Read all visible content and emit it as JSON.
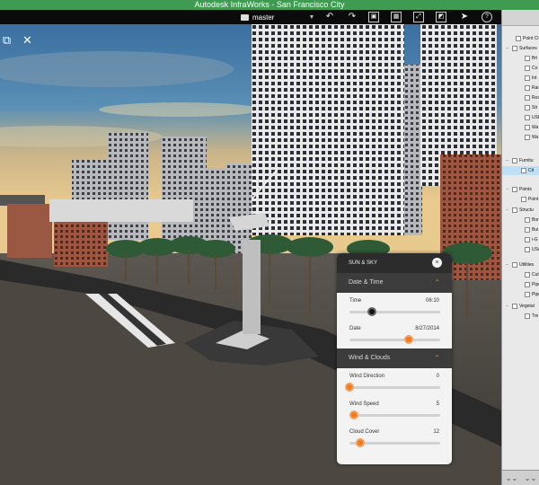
{
  "window": {
    "title": "Autodesk InfraWorks - San Francisco City"
  },
  "toolbar": {
    "project_name": "master",
    "dropdown_arrow": "▼",
    "icons": [
      "undo-icon",
      "redo-icon",
      "view-icon",
      "grid-icon",
      "capture-icon",
      "pointer-icon",
      "help-icon"
    ]
  },
  "scene_tools": {
    "icons": [
      "presentation-icon",
      "tools-icon"
    ]
  },
  "sun_sky_panel": {
    "title": "SUN & SKY",
    "close_glyph": "×",
    "sections": [
      {
        "label": "Date & Time",
        "rows": [
          {
            "label": "Time",
            "value": "06:10",
            "level": 0.25,
            "dark": true
          },
          {
            "label": "Date",
            "value": "8/27/2014",
            "level": 0.65,
            "dark": false
          }
        ]
      },
      {
        "label": "Wind & Clouds",
        "rows": [
          {
            "label": "Wind Direction",
            "value": "0",
            "level": 0.0,
            "dark": false
          },
          {
            "label": "Wind Speed",
            "value": "5",
            "level": 0.05,
            "dark": false
          },
          {
            "label": "Cloud Cover",
            "value": "12",
            "level": 0.12,
            "dark": false
          }
        ]
      }
    ]
  },
  "sidebar": {
    "items": [
      {
        "label": "Point Cl",
        "toggle": ""
      },
      {
        "label": "Surfaces",
        "toggle": "−"
      },
      {
        "label": "Bri",
        "toggle": ""
      },
      {
        "label": "Co",
        "toggle": ""
      },
      {
        "label": "Int",
        "toggle": ""
      },
      {
        "label": "Rai",
        "toggle": ""
      },
      {
        "label": "Roa",
        "toggle": ""
      },
      {
        "label": "Str",
        "toggle": ""
      },
      {
        "label": "USE",
        "toggle": ""
      },
      {
        "label": "Wa",
        "toggle": ""
      },
      {
        "label": "Wa",
        "toggle": ""
      },
      {
        "label": "Furnitu",
        "toggle": "−"
      },
      {
        "label": "Cit",
        "toggle": "",
        "selected": true
      },
      {
        "label": "Points",
        "toggle": "−"
      },
      {
        "label": "Point",
        "toggle": ""
      },
      {
        "label": "Structu",
        "toggle": "−"
      },
      {
        "label": "Bor",
        "toggle": ""
      },
      {
        "label": "Bui",
        "toggle": ""
      },
      {
        "label": "i-G",
        "toggle": ""
      },
      {
        "label": "USe",
        "toggle": ""
      },
      {
        "label": "Utilities",
        "toggle": "−"
      },
      {
        "label": "Cut",
        "toggle": ""
      },
      {
        "label": "Pipe",
        "toggle": ""
      },
      {
        "label": "Pipe",
        "toggle": ""
      },
      {
        "label": "Vegetat",
        "toggle": "−"
      },
      {
        "label": "Tre",
        "toggle": ""
      }
    ],
    "bottom_glyphs": [
      "⌄⌄",
      "⌄⌄"
    ]
  }
}
